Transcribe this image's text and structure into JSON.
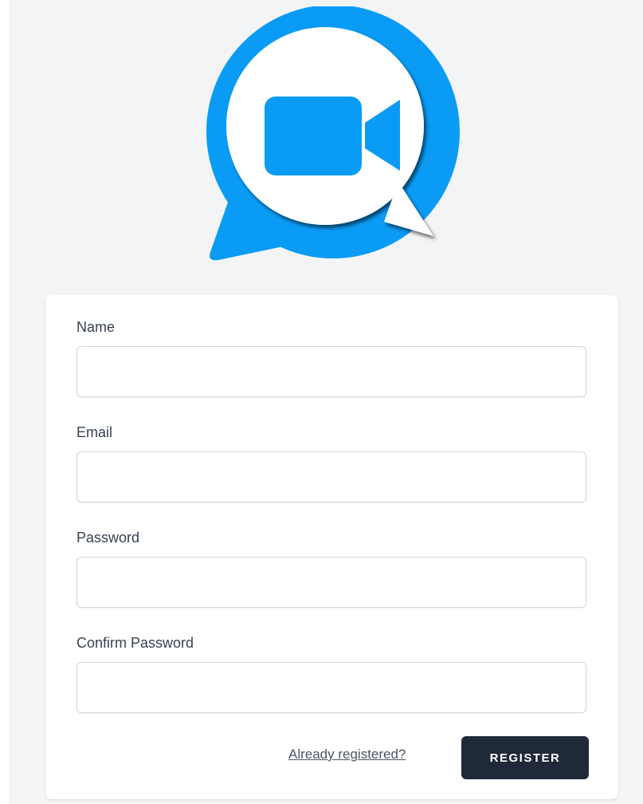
{
  "logo": {
    "icon": "video-camera-chat-bubble-icon",
    "colors": {
      "primary": "#0a9bf5",
      "inner": "#ffffff"
    }
  },
  "form": {
    "fields": [
      {
        "label": "Name",
        "value": "",
        "type": "text"
      },
      {
        "label": "Email",
        "value": "",
        "type": "email"
      },
      {
        "label": "Password",
        "value": "",
        "type": "password"
      },
      {
        "label": "Confirm Password",
        "value": "",
        "type": "password"
      }
    ],
    "login_link": "Already registered?",
    "submit_label": "REGISTER"
  },
  "colors": {
    "page_background": "#f3f4f6",
    "card_background": "#ffffff",
    "button_background": "#1f2937",
    "button_text": "#ffffff"
  }
}
